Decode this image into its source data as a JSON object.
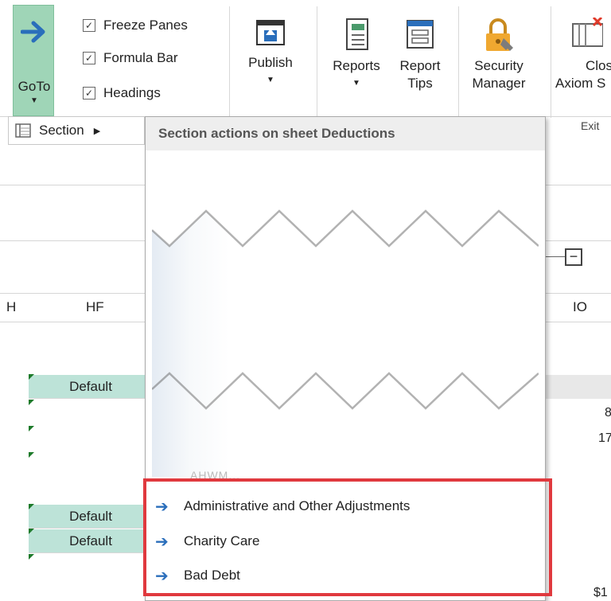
{
  "ribbon": {
    "goto_label": "GoTo",
    "checkboxes": [
      {
        "label": "Freeze Panes",
        "checked": true
      },
      {
        "label": "Formula Bar",
        "checked": true
      },
      {
        "label": "Headings",
        "checked": true
      }
    ],
    "publish_label": "Publish",
    "reports_label": "Reports",
    "report_tips_line1": "Report",
    "report_tips_line2": "Tips",
    "security_line1": "Security",
    "security_line2": "Manager",
    "close_line1": "Close",
    "close_line2": "Axiom S",
    "exit_group": "Exit"
  },
  "section_item": {
    "label": "Section"
  },
  "dropdown": {
    "header": "Section actions on sheet Deductions",
    "partial_item": "AHWM...",
    "items": [
      {
        "label": "Administrative and Other Adjustments"
      },
      {
        "label": "Charity Care"
      },
      {
        "label": "Bad Debt"
      }
    ]
  },
  "sheet": {
    "col_h": "H",
    "col_hf": "HF",
    "col_io": "IO",
    "default_label": "Default",
    "right_values": [
      "8",
      "17",
      "$1"
    ]
  },
  "colors": {
    "accent_green": "#9fd5b7",
    "row_fill": "#bde3d8",
    "highlight": "#e0393e",
    "arrow_blue": "#2a6ebb"
  }
}
